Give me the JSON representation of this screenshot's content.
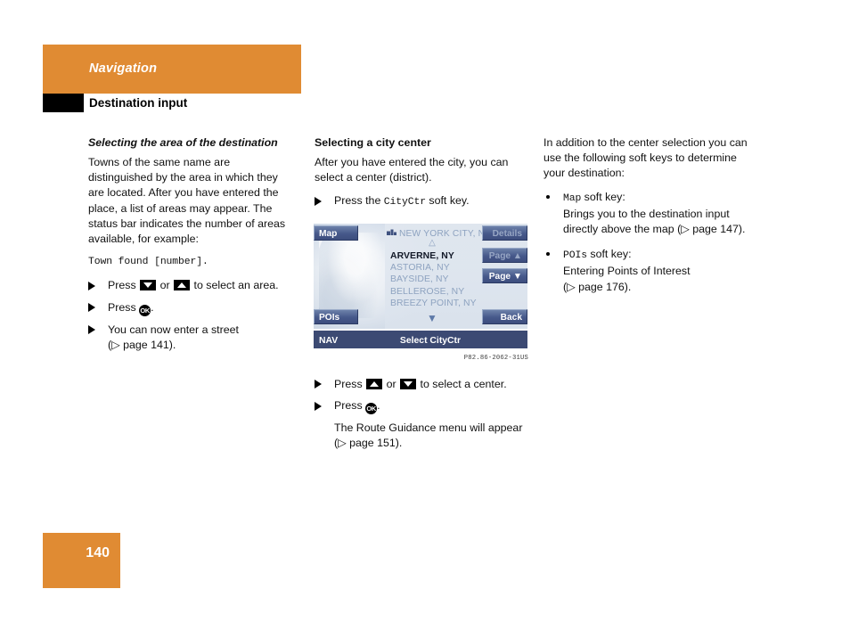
{
  "header": {
    "chapter": "Navigation",
    "section": "Destination input",
    "accent_color": "#e08b33"
  },
  "left_column": {
    "heading": "Selecting the area of the destination",
    "paragraph": "Towns of the same name are distinguished by the area in which they are located. After you have entered the place, a list of areas may appear. The status bar indicates the number of areas available, for example:",
    "status_example": "Town found [number].",
    "steps": [
      {
        "pre": "Press ",
        "key1": "down-arrow-key",
        "mid": " or ",
        "key2": "up-arrow-key",
        "post": " to select an area."
      },
      {
        "pre": "Press ",
        "key": "ok-key",
        "post": "."
      }
    ],
    "step_select_area_pre": "Press",
    "step_select_area_mid": "or",
    "step_select_area_post": "to select an area.",
    "step_press_ok_pre": "Press",
    "step_enter_street": "You can now enter a street",
    "step_enter_street_ref": "(▷ page 141)."
  },
  "middle_column": {
    "heading": "Selecting a city center",
    "paragraph": "After you have entered the city, you can select a center (district).",
    "step_citycentre_pre": "Press the",
    "step_citycentre_key": "CityCtr",
    "step_citycentre_post": "soft key.",
    "step_select_center_pre": "Press",
    "step_select_center_mid": "or",
    "step_select_center_post": "to select a center.",
    "step_press_ok_pre": "Press",
    "result_text": "The Route Guidance menu will appear",
    "result_ref": "(▷ page 151).",
    "caption": "P82.86-2062-31US"
  },
  "device": {
    "title": "NEW YORK CITY, NY",
    "title_icon": "city-buildings-icon",
    "scroll_up_icon": "△",
    "scroll_down_icon": "▼",
    "list": [
      {
        "label": "ARVERNE, NY",
        "selected": true
      },
      {
        "label": "ASTORIA, NY",
        "selected": false
      },
      {
        "label": "BAYSIDE, NY",
        "selected": false
      },
      {
        "label": "BELLEROSE, NY",
        "selected": false
      },
      {
        "label": "BREEZY POINT, NY",
        "selected": false
      }
    ],
    "softkeys": {
      "map": "Map",
      "pois": "POIs",
      "details": "Details",
      "page_up": "Page ▲",
      "page_down": "Page ▼",
      "back": "Back"
    },
    "status_left": "NAV",
    "status_center": "Select CityCtr",
    "colors": {
      "softkey_fill": "#46588a",
      "status_bar": "#3c4a73",
      "list_text": "#8ea3c0",
      "selected_text": "#111827",
      "screen_bg": "#d7dfe9"
    }
  },
  "right_column": {
    "paragraph": "In addition to the center selection you can use the following soft keys to determine your destination:",
    "bullets": [
      {
        "key": "Map",
        "key_suffix": " soft key:",
        "line1": "Brings you to the destination input",
        "line2": "directly above the map (▷ page 147)."
      },
      {
        "key": "POIs",
        "key_suffix": " soft key:",
        "line1": "Entering Points of Interest",
        "line2": "(▷ page 176)."
      }
    ]
  },
  "footer": {
    "page_number": "140"
  }
}
